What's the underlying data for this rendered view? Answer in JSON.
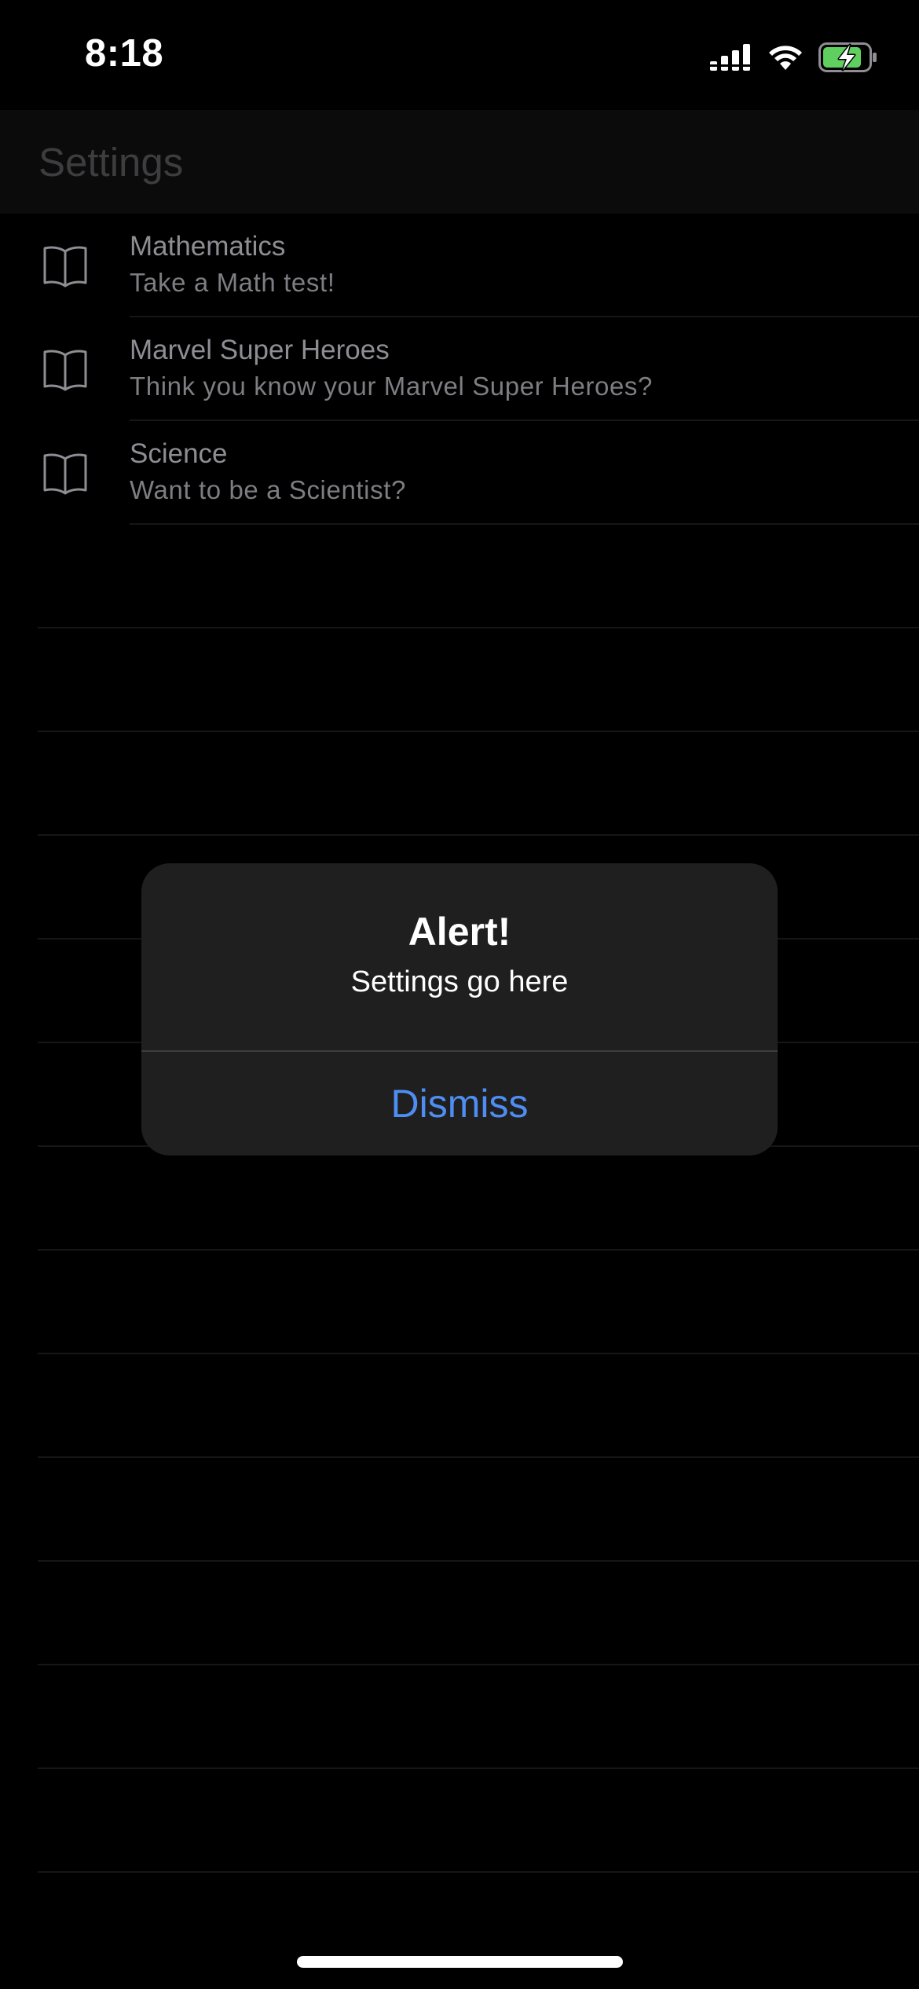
{
  "status_bar": {
    "time": "8:18",
    "icons": [
      "cellular-signal-icon",
      "wifi-icon",
      "battery-charging-icon"
    ],
    "battery_color": "#5fd05f"
  },
  "nav": {
    "title": "Settings"
  },
  "list": {
    "items": [
      {
        "icon": "book-icon",
        "title": "Mathematics",
        "subtitle": "Take a Math test!"
      },
      {
        "icon": "book-icon",
        "title": "Marvel Super Heroes",
        "subtitle": "Think you know your Marvel Super Heroes?"
      },
      {
        "icon": "book-icon",
        "title": "Science",
        "subtitle": "Want to be a Scientist?"
      }
    ]
  },
  "alert": {
    "title": "Alert!",
    "message": "Settings go here",
    "button_label": "Dismiss",
    "button_color": "#4e8ef3"
  },
  "colors": {
    "background": "#000000",
    "alert_background": "#1f1f20",
    "accent": "#4e8ef3"
  }
}
